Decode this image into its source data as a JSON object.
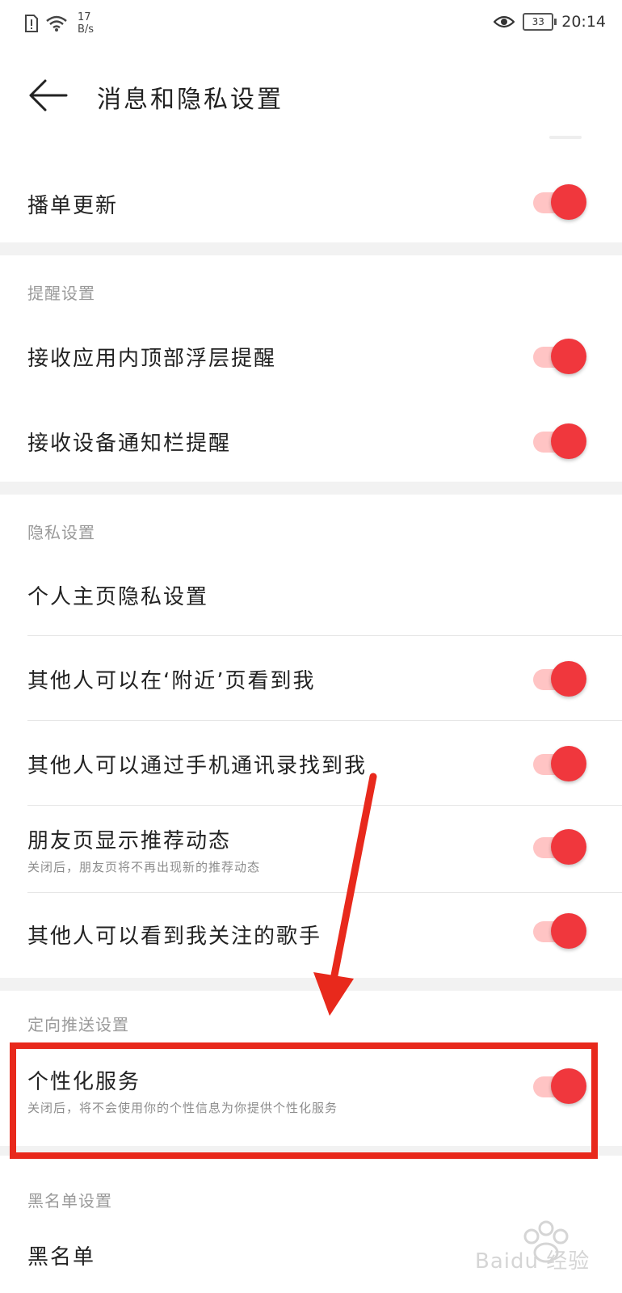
{
  "statusbar": {
    "speed_value": "17",
    "speed_unit": "B/s",
    "battery": "33",
    "time": "20:14"
  },
  "appbar": {
    "title": "消息和隐私设置"
  },
  "items": {
    "playlist_update": {
      "label": "播单更新",
      "on": true
    },
    "reminder_header": "提醒设置",
    "in_app_top": {
      "label": "接收应用内顶部浮层提醒",
      "on": true
    },
    "notification_bar": {
      "label": "接收设备通知栏提醒",
      "on": true
    },
    "privacy_header": "隐私设置",
    "profile_privacy": {
      "label": "个人主页隐私设置"
    },
    "nearby": {
      "label": "其他人可以在‘附近’页看到我",
      "on": true
    },
    "contacts": {
      "label": "其他人可以通过手机通讯录找到我",
      "on": true
    },
    "friends_feed": {
      "label": "朋友页显示推荐动态",
      "sub": "关闭后，朋友页将不再出现新的推荐动态",
      "on": true
    },
    "followed_singers": {
      "label": "其他人可以看到我关注的歌手",
      "on": true
    },
    "targeted_header": "定向推送设置",
    "personalized": {
      "label": "个性化服务",
      "sub": "关闭后，将不会使用你的个性信息为你提供个性化服务",
      "on": true
    },
    "blacklist_header": "黑名单设置",
    "blacklist": {
      "label": "黑名单"
    }
  },
  "watermark": {
    "text": "Baidu 经验"
  },
  "colors": {
    "accent": "#f0373d",
    "track": "#ffc4c4",
    "annotation": "#e8291c"
  }
}
